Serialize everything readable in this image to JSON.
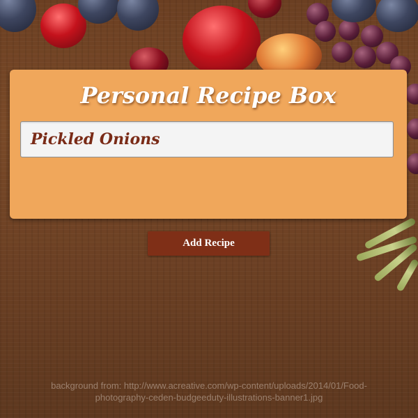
{
  "app": {
    "title": "Personal Recipe Box"
  },
  "recipes": [
    {
      "name": "Pickled Onions"
    }
  ],
  "actions": {
    "add_label": "Add Recipe"
  },
  "footer": {
    "credit_line1": "background from: http://www.acreative.com/wp-content/uploads/2014/01/Food-",
    "credit_line2": "photography-ceden-budgeeduty-illustrations-banner1.jpg"
  },
  "colors": {
    "panel": "#f0a75b",
    "button": "#7f2f17",
    "recipe_text": "#7a2b17"
  }
}
